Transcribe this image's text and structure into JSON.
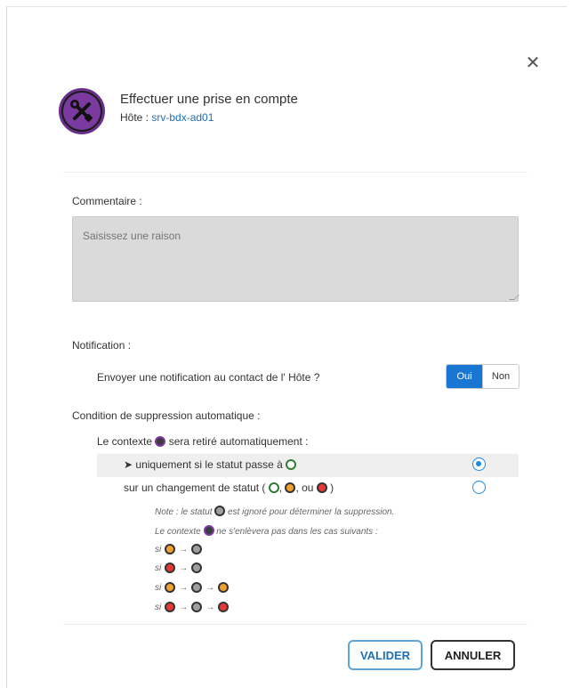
{
  "header": {
    "title": "Effectuer une prise en compte",
    "host_label": "Hôte :",
    "host_value": "srv-bdx-ad01",
    "close_glyph": "✕"
  },
  "comment": {
    "label": "Commentaire :",
    "placeholder": "Saisissez une raison",
    "value": ""
  },
  "notification": {
    "section_label": "Notification :",
    "question": "Envoyer une notification au contact de l' Hôte ?",
    "yes_label": "Oui",
    "no_label": "Non",
    "selected": "Oui"
  },
  "auto_removal": {
    "section_label": "Condition de suppression automatique :",
    "context_prefix": "Le contexte",
    "context_suffix": "sera retiré automatiquement :",
    "option1_prefix": "➤ uniquement si le statut passe à",
    "option2_prefix": "sur un changement de statut (",
    "option2_sep1": ",",
    "option2_sep2": ", ou",
    "option2_suffix": ")",
    "selected_option": 1,
    "note1_prefix": "Note : le statut",
    "note1_suffix": "est ignoré pour déterminer la suppression.",
    "note2_prefix": "Le contexte",
    "note2_suffix": "ne s'enlèvera pas dans les cas suivants :",
    "case_prefix": "si",
    "arrow": "→"
  },
  "buttons": {
    "validate": "VALIDER",
    "cancel": "ANNULER"
  },
  "colors": {
    "primary": "#1976d2",
    "link": "#1f6fb2",
    "context_purple": "#7b3aa0",
    "ok_green": "#2e7d32",
    "warning_orange": "#f0a030",
    "critical_red": "#e53935",
    "unknown_gray": "#9e9e9e"
  }
}
